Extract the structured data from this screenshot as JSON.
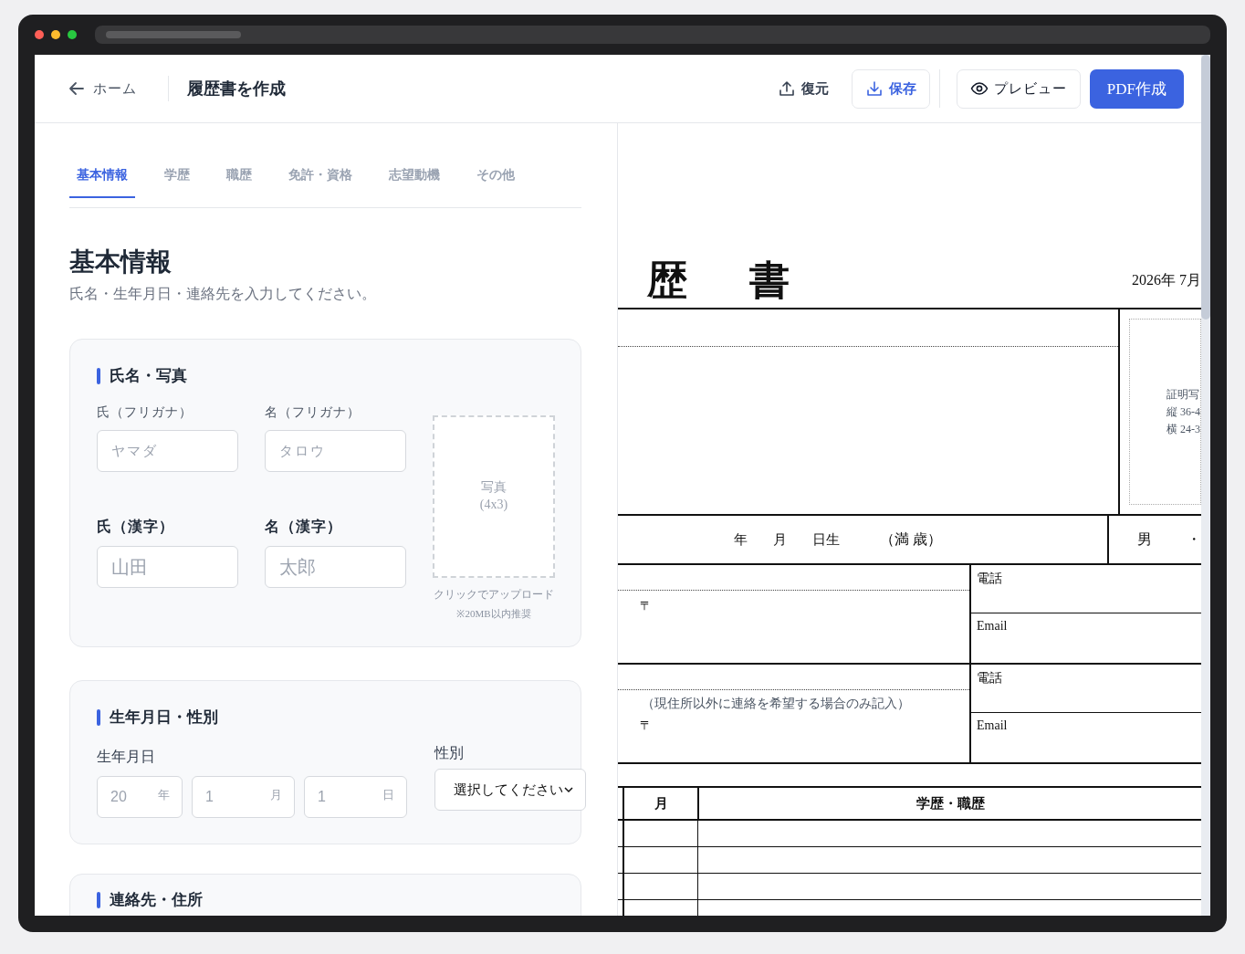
{
  "header": {
    "back": "ホーム",
    "title": "履歴書を作成",
    "actions": [
      {
        "label": "復元",
        "kind": "restore"
      },
      {
        "label": "保存",
        "kind": "save"
      },
      {
        "label": "プレビュー",
        "kind": "preview"
      },
      {
        "label": "PDF作成",
        "kind": "primary"
      }
    ]
  },
  "tabs": [
    {
      "label": "基本情報",
      "selected": true
    },
    {
      "label": "学歴",
      "selected": false
    },
    {
      "label": "職歴",
      "selected": false
    },
    {
      "label": "免許・資格",
      "selected": false
    },
    {
      "label": "志望動機",
      "selected": false
    },
    {
      "label": "その他",
      "selected": false
    }
  ],
  "section": {
    "title": "基本情報",
    "description": "氏名・生年月日・連絡先を入力してください。"
  },
  "name_card": {
    "title": "氏名・写真",
    "fields": [
      {
        "label": "氏（フリガナ）",
        "placeholder": "ヤマダ",
        "kind": "kana"
      },
      {
        "label": "名（フリガナ）",
        "placeholder": "タロウ",
        "kind": "kana"
      },
      {
        "label": "氏（漢字）",
        "placeholder": "山田",
        "kind": "kanji"
      },
      {
        "label": "名（漢字）",
        "placeholder": "太郎",
        "kind": "kanji"
      }
    ],
    "photo": {
      "label": "写真",
      "size": "(4x3)",
      "hint": "クリックでアップロード",
      "note": "※20MB以内推奨"
    }
  },
  "birth_card": {
    "title": "生年月日・性別",
    "birth_label": "生年月日",
    "date_fields": [
      {
        "placeholder": "20",
        "unit": "年"
      },
      {
        "placeholder": "1",
        "unit": "月"
      },
      {
        "placeholder": "1",
        "unit": "日"
      }
    ],
    "gender_label": "性別",
    "gender_select": {
      "value": "選択してください"
    }
  },
  "contact_card": {
    "title": "連絡先・住所"
  },
  "preview": {
    "title": "歴　書",
    "date": "2026年 7月",
    "photo_note": [
      "証明写",
      "縦 36-4",
      "横 24-3"
    ],
    "birth_row": [
      "年",
      "月",
      "日生",
      "（満 歳）"
    ],
    "gender": [
      "男",
      "・"
    ],
    "addresses": [
      {
        "postal": "〒",
        "phone": "電話",
        "email": "Email"
      },
      {
        "note": "（現住所以外に連絡を希望する場合のみ記入）",
        "postal": "〒",
        "phone": "電話",
        "email": "Email"
      }
    ],
    "history_columns": [
      "月",
      "学歴・職歴"
    ]
  }
}
